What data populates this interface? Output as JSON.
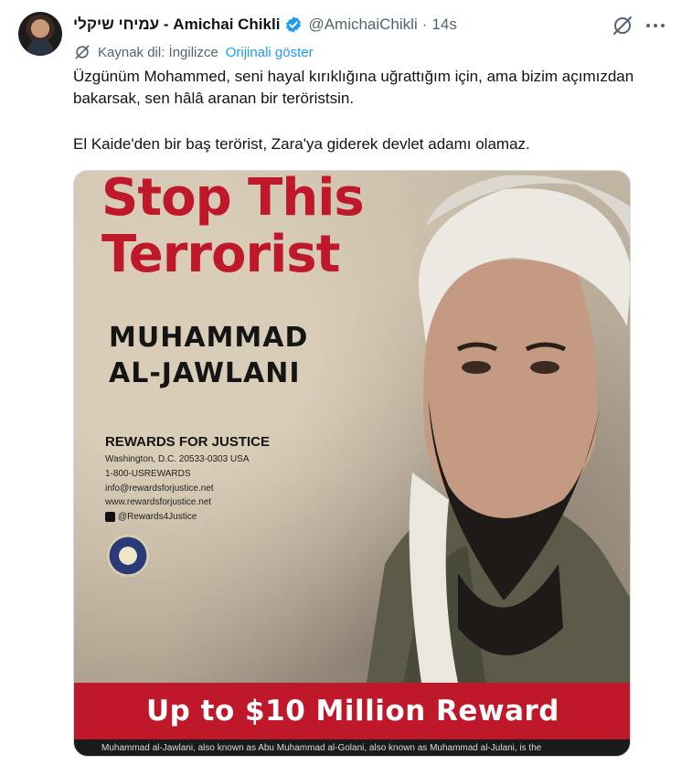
{
  "author": {
    "display_name": "עמיחי שיקלי - Amichai Chikli",
    "handle": "@AmichaiChikli",
    "time": "14s",
    "separator": "·"
  },
  "translation": {
    "source_label": "Kaynak dil: İngilizce",
    "show_original": "Orijinali göster"
  },
  "tweet": {
    "paragraph_1": "Üzgünüm Mohammed, seni hayal kırıklığına uğrattığım için, ama bizim açımızdan bakarsak, sen hâlâ aranan bir teröristsin.",
    "paragraph_2": "El Kaide'den bir baş terörist, Zara'ya giderek devlet adamı olamaz."
  },
  "poster": {
    "headline_1": "Stop This",
    "headline_2": "Terrorist",
    "name_1": "MUHAMMAD",
    "name_2": "AL-JAWLANI",
    "rfj_title": "REWARDS FOR JUSTICE",
    "rfj_address": "Washington, D.C. 20533-0303 USA",
    "rfj_phone": "1-800-USREWARDS",
    "rfj_email": "info@rewardsforjustice.net",
    "rfj_web": "www.rewardsforjustice.net",
    "rfj_twitter": "@Rewards4Justice",
    "banner": "Up to $10 Million Reward",
    "footer": "Muhammad al-Jawlani, also known as Abu Muhammad al-Golani, also known as Muhammad al-Julani, is the"
  },
  "icons": {
    "verified": "verified-badge-icon",
    "grok": "grok-icon",
    "more": "more-options-icon",
    "translate": "translate-icon"
  },
  "colors": {
    "text_primary": "#0f1419",
    "text_secondary": "#536471",
    "link": "#1d9bf0",
    "verified": "#1d9bf0",
    "poster_red": "#c0182b"
  }
}
